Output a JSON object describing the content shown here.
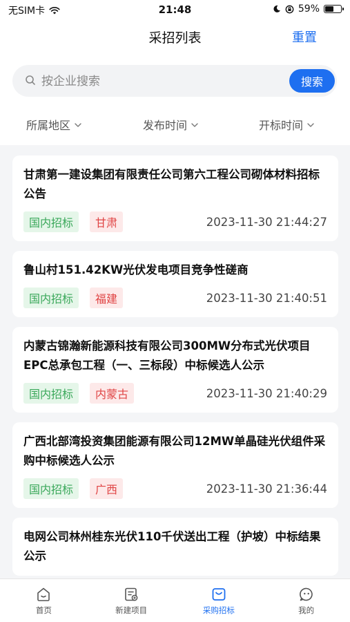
{
  "status_bar": {
    "carrier": "无SIM卡",
    "time": "21:48",
    "battery": "59%",
    "battery_level": 0.59
  },
  "header": {
    "title": "采招列表",
    "reset_label": "重置"
  },
  "search": {
    "placeholder": "按企业搜索",
    "button_label": "搜索"
  },
  "filters": [
    {
      "label": "所属地区"
    },
    {
      "label": "发布时间"
    },
    {
      "label": "开标时间"
    }
  ],
  "items": [
    {
      "title": "甘肃第一建设集团有限责任公司第六工程公司砌体材料招标公告",
      "type": "国内招标",
      "region": "甘肃",
      "time": "2023-11-30 21:44:27"
    },
    {
      "title": "鲁山村151.42KW光伏发电项目竞争性磋商",
      "type": "国内招标",
      "region": "福建",
      "time": "2023-11-30 21:40:51"
    },
    {
      "title": "内蒙古锦瀚新能源科技有限公司300MW分布式光伏项目EPC总承包工程（一、三标段）中标候选人公示",
      "type": "国内招标",
      "region": "内蒙古",
      "time": "2023-11-30 21:40:29"
    },
    {
      "title": "广西北部湾投资集团能源有限公司12MW单晶硅光伏组件采购中标候选人公示",
      "type": "国内招标",
      "region": "广西",
      "time": "2023-11-30 21:36:44"
    },
    {
      "title": "电网公司林州桂东光伏110千伏送出工程（护坡）中标结果公示",
      "type": "",
      "region": "",
      "time": ""
    }
  ],
  "tabbar": [
    {
      "label": "首页",
      "icon": "home-icon"
    },
    {
      "label": "新建项目",
      "icon": "new-project-icon"
    },
    {
      "label": "采购招标",
      "icon": "procurement-icon",
      "active": true
    },
    {
      "label": "我的",
      "icon": "profile-icon"
    }
  ],
  "colors": {
    "accent": "#1e6ff0",
    "tag_type_bg": "#e5f6e9",
    "tag_type_text": "#3aa85a",
    "tag_region_bg": "#fde9e9",
    "tag_region_text": "#e04444"
  }
}
